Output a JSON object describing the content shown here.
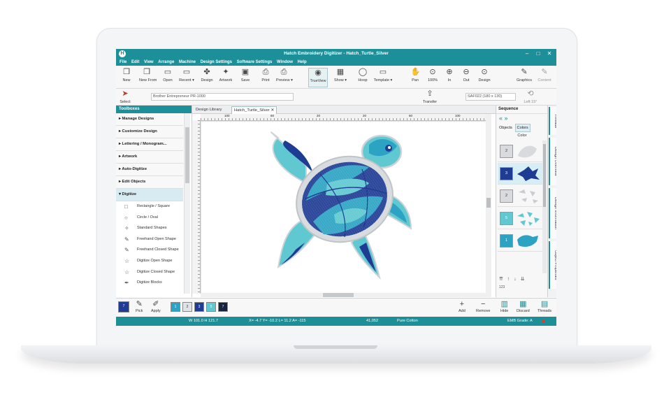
{
  "window": {
    "title": "Hatch Embroidery Digitizer - Hatch_Turtle_Silver",
    "app_icon": "hatch-logo-icon",
    "controls": [
      "–",
      "□",
      "✕"
    ]
  },
  "menu": [
    "File",
    "Edit",
    "View",
    "Arrange",
    "Machine",
    "Design Settings",
    "Software Settings",
    "Window",
    "Help"
  ],
  "toolbar": [
    {
      "label": "New",
      "icon": "❒"
    },
    {
      "label": "New From",
      "icon": "❒"
    },
    {
      "label": "Open",
      "icon": "▭"
    },
    {
      "label": "Recent ▾",
      "icon": "▭"
    },
    {
      "label": "Design",
      "icon": "✤"
    },
    {
      "label": "Artwork",
      "icon": "✦"
    },
    {
      "label": "Save",
      "icon": "▣"
    },
    {
      "label": "Print",
      "icon": "⎙"
    },
    {
      "label": "Preview ▾",
      "icon": "⎙"
    },
    {
      "label": "TrueView",
      "icon": "◉"
    },
    {
      "label": "Show ▾",
      "icon": "▦"
    },
    {
      "label": "Hoop",
      "icon": "◯"
    },
    {
      "label": "Template ▾",
      "icon": "▭"
    },
    {
      "label": "Pan",
      "icon": "✋"
    },
    {
      "label": "100%",
      "icon": "⊙"
    },
    {
      "label": "In",
      "icon": "⊕"
    },
    {
      "label": "Out",
      "icon": "⊖"
    },
    {
      "label": "Design",
      "icon": "⊙"
    },
    {
      "label": "Graphics",
      "icon": "✎"
    },
    {
      "label": "Content",
      "icon": "✎"
    }
  ],
  "optionbar": {
    "select_label": "Select",
    "machine": "Brother Entrepreneur PR-1000",
    "transfer_label": "Transfer",
    "hoop": "SAF022 (180 x 130)",
    "rotate": "Left 15°"
  },
  "toolbox": {
    "header": "Toolboxes",
    "categories": [
      "Manage Designs",
      "Customize Design",
      "Lettering / Monogram...",
      "Artwork",
      "Auto-Digitize",
      "Edit Objects",
      "Digitize"
    ],
    "tools": [
      {
        "label": "Rectangle / Square",
        "icon": "□"
      },
      {
        "label": "Circle / Oval",
        "icon": "○"
      },
      {
        "label": "Standard Shapes",
        "icon": "✧"
      },
      {
        "label": "Freehand Open Shape",
        "icon": "✎"
      },
      {
        "label": "Freehand Closed Shape",
        "icon": "✎"
      },
      {
        "label": "Digitize Open Shape",
        "icon": "☆"
      },
      {
        "label": "Digitize Closed Shape",
        "icon": "☆"
      },
      {
        "label": "Digitize Blocks",
        "icon": "✒"
      }
    ]
  },
  "doctabs": [
    "Design Library",
    "Hatch_Turtle_Silver"
  ],
  "ruler_labels": [
    "100",
    "60",
    "20",
    "20",
    "60",
    "100"
  ],
  "sequence": {
    "header": "Sequence",
    "nav": "« »",
    "tabs": [
      "Objects",
      "Colors"
    ],
    "color_label": "Color",
    "rows": [
      {
        "num": "2",
        "color": "#d8dadd"
      },
      {
        "num": "3",
        "color": "#1f3c94"
      },
      {
        "num": "2",
        "color": "#d8dadd"
      },
      {
        "num": "5",
        "color": "#5fc8d1"
      },
      {
        "num": "1",
        "color": "#2ca3c3"
      }
    ],
    "bottom_tools": "⇈ ↑ ↓ ⇊",
    "bottom_label": "123"
  },
  "sidetabs": [
    "Threads",
    "Design Overview",
    "Design Information",
    "Object Properties"
  ],
  "bottombar": {
    "buttons": [
      {
        "label": "Pick",
        "icon": "✎"
      },
      {
        "label": "Apply",
        "icon": "✐"
      },
      {
        "label": "Add",
        "icon": "+"
      },
      {
        "label": "Remove",
        "icon": "−"
      },
      {
        "label": "Hide",
        "icon": "▥"
      },
      {
        "label": "Discard",
        "icon": "▦"
      },
      {
        "label": "Threads",
        "icon": "▤"
      }
    ],
    "current_color": "7",
    "swatches": [
      {
        "num": "1",
        "color": "#2ca3c3"
      },
      {
        "num": "2",
        "color": "#dfe3e6"
      },
      {
        "num": "3",
        "color": "#1f3c94"
      },
      {
        "num": "5",
        "color": "#5fc8d1"
      },
      {
        "num": "7",
        "color": "#15233f"
      }
    ]
  },
  "status": {
    "size": "W 101.0 H 121.7",
    "coords": "X= -4.7 Y= -10.2 L= 11.2 A= -115",
    "stitches": "41,052",
    "thread": "Pure Cotton",
    "grade": "EMB Grade: A"
  },
  "colors": {
    "accent": "#1d8f99",
    "turtle_dark": "#1f3c94",
    "turtle_light": "#5fc8d1",
    "turtle_mid": "#2ca3c3",
    "silver": "#d8dadd"
  }
}
